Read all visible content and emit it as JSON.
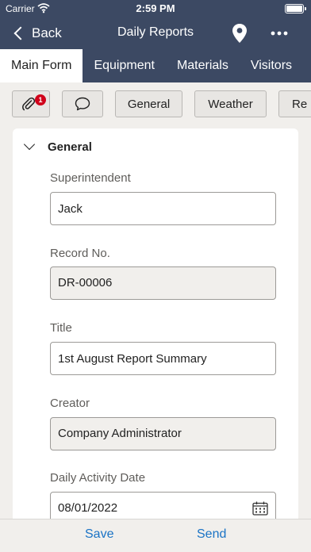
{
  "status_bar": {
    "carrier": "Carrier",
    "time": "2:59 PM"
  },
  "nav": {
    "back_label": "Back",
    "title": "Daily Reports"
  },
  "tabs": [
    {
      "label": "Main Form",
      "active": true
    },
    {
      "label": "Equipment",
      "active": false
    },
    {
      "label": "Materials",
      "active": false
    },
    {
      "label": "Visitors",
      "active": false
    }
  ],
  "chips": {
    "attachment_badge": "1",
    "general": "General",
    "weather": "Weather",
    "next_partial": "Re"
  },
  "section": {
    "title": "General"
  },
  "fields": {
    "superintendent": {
      "label": "Superintendent",
      "value": "Jack"
    },
    "record_no": {
      "label": "Record No.",
      "value": "DR-00006"
    },
    "title": {
      "label": "Title",
      "value": "1st August Report Summary"
    },
    "creator": {
      "label": "Creator",
      "value": "Company Administrator"
    },
    "activity_date": {
      "label": "Daily Activity Date",
      "value": "08/01/2022"
    }
  },
  "bottom": {
    "save": "Save",
    "send": "Send"
  },
  "colors": {
    "header": "#3c4963",
    "accent": "#1a73c5",
    "badge": "#d0021b",
    "background": "#f1efec"
  },
  "icons": [
    "wifi-icon",
    "battery-icon",
    "back-chevron-icon",
    "location-pin-icon",
    "more-icon",
    "paperclip-icon",
    "comment-icon",
    "chevron-down-icon",
    "calendar-icon"
  ]
}
